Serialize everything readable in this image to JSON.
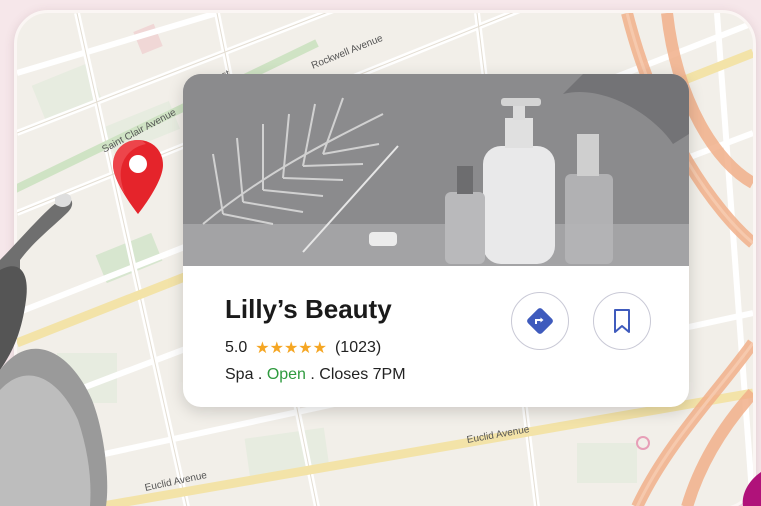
{
  "map": {
    "streets": {
      "rockwell": "Rockwell Avenue",
      "saint_clair": "Saint Clair Avenue",
      "east_fragment": "ast",
      "euclid_right": "Euclid Avenue",
      "euclid_left": "Euclid Avenue"
    },
    "pin_icon": "map-pin-icon",
    "accent_color": "#e5242b"
  },
  "place_card": {
    "name": "Lilly’s Beauty",
    "rating": "5.0",
    "stars": "★★★★★",
    "review_count": "(1023)",
    "category": "Spa",
    "separator_1": " . ",
    "status": "Open",
    "separator_2": " . ",
    "closing": "Closes 7PM",
    "status_color": "#2e9a3e",
    "star_color": "#f5a623",
    "directions_icon": "directions-icon",
    "bookmark_icon": "bookmark-icon"
  }
}
